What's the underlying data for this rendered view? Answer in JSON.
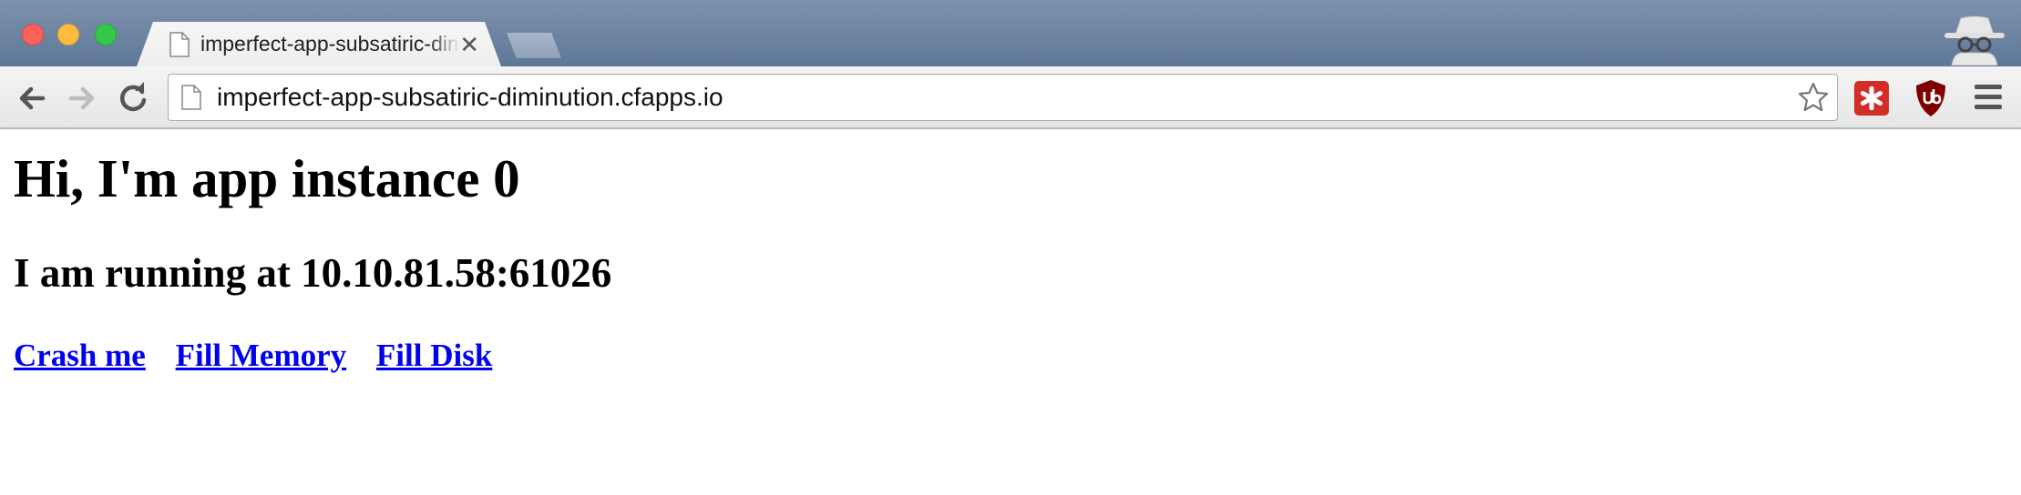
{
  "browser": {
    "tab": {
      "title": "imperfect-app-subsatiric-diminution.cfapps.io",
      "close_glyph": "✕"
    },
    "omnibox": {
      "url": "imperfect-app-subsatiric-diminution.cfapps.io"
    },
    "icons": {
      "back": "back-arrow-icon",
      "forward": "forward-arrow-icon",
      "reload": "reload-icon",
      "bookmark": "star-icon",
      "lastpass": "lastpass-icon",
      "ublock": "ublock-origin-icon",
      "menu": "hamburger-menu-icon",
      "incognito": "incognito-icon"
    },
    "colors": {
      "titlebar": "#6b819f",
      "lastpass": "#d32d27",
      "ublock": "#800000"
    }
  },
  "page": {
    "heading": "Hi, I'm app instance 0",
    "subheading": "I am running at 10.10.81.58:61026",
    "links": [
      {
        "label": "Crash me"
      },
      {
        "label": "Fill Memory"
      },
      {
        "label": "Fill Disk"
      }
    ],
    "link_color": "#0000ee"
  }
}
